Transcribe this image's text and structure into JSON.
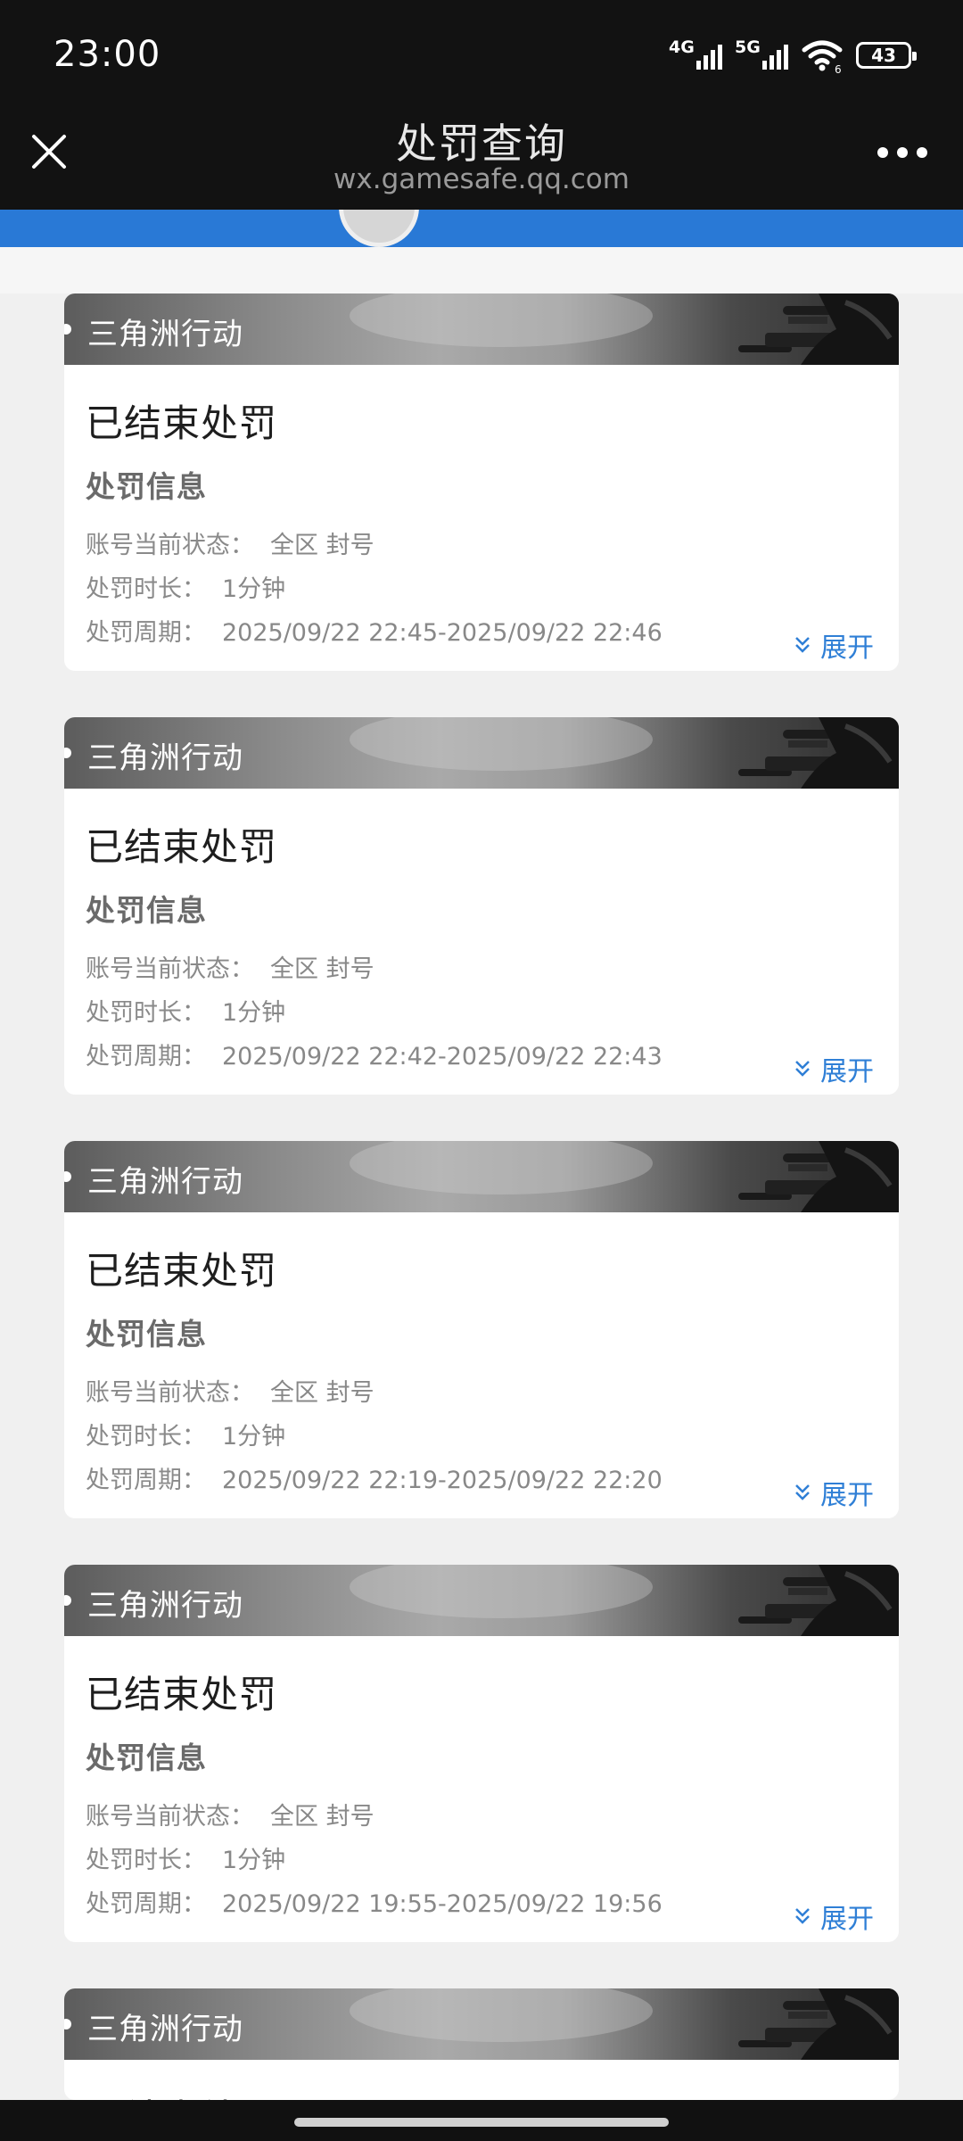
{
  "status_bar": {
    "time": "23:00",
    "signal_1": "4G",
    "signal_2": "5G",
    "wifi_badge": "6",
    "battery": "43",
    "icons": [
      "signal-4g-icon",
      "signal-5g-icon",
      "wifi-icon",
      "battery-icon"
    ]
  },
  "title_bar": {
    "title": "处罚查询",
    "url": "wx.gamesafe.qq.com",
    "close_icon": "close-icon",
    "more_icon": "more-icon"
  },
  "cards": [
    {
      "game": "三角洲行动",
      "status": "已结束处罚",
      "section": "处罚信息",
      "account_state_label": "账号当前状态：",
      "account_state": "全区 封号",
      "duration_label": "处罚时长：",
      "duration": "1分钟",
      "period_label": "处罚周期：",
      "period": "2025/09/22 22:45-2025/09/22 22:46",
      "expand": "展开"
    },
    {
      "game": "三角洲行动",
      "status": "已结束处罚",
      "section": "处罚信息",
      "account_state_label": "账号当前状态：",
      "account_state": "全区 封号",
      "duration_label": "处罚时长：",
      "duration": "1分钟",
      "period_label": "处罚周期：",
      "period": "2025/09/22 22:42-2025/09/22 22:43",
      "expand": "展开"
    },
    {
      "game": "三角洲行动",
      "status": "已结束处罚",
      "section": "处罚信息",
      "account_state_label": "账号当前状态：",
      "account_state": "全区 封号",
      "duration_label": "处罚时长：",
      "duration": "1分钟",
      "period_label": "处罚周期：",
      "period": "2025/09/22 22:19-2025/09/22 22:20",
      "expand": "展开"
    },
    {
      "game": "三角洲行动",
      "status": "已结束处罚",
      "section": "处罚信息",
      "account_state_label": "账号当前状态：",
      "account_state": "全区 封号",
      "duration_label": "处罚时长：",
      "duration": "1分钟",
      "period_label": "处罚周期：",
      "period": "2025/09/22 19:55-2025/09/22 19:56",
      "expand": "展开"
    },
    {
      "game": "三角洲行动",
      "status": "已结束处罚"
    }
  ],
  "colors": {
    "header_bg": "#121212",
    "accent_blue": "#2979d6",
    "link_blue": "#2f7fd6",
    "page_bg": "#f0f0f0"
  }
}
